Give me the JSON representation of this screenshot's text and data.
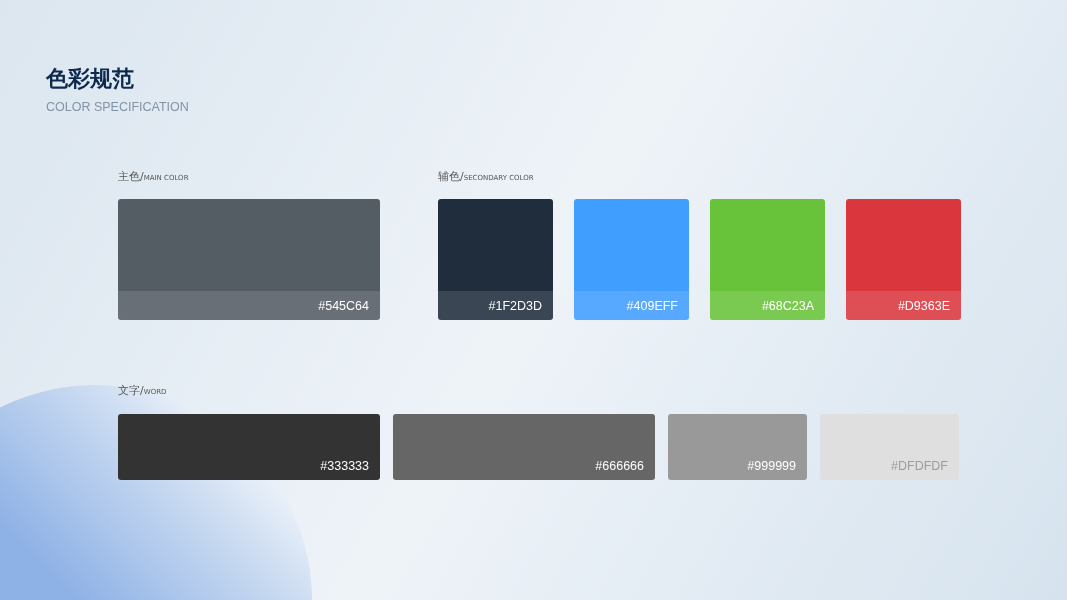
{
  "title": "色彩规范",
  "subtitle": "COLOR SPECIFICATION",
  "main": {
    "label": {
      "cn": "主色/",
      "en": "MAIN COLOR"
    },
    "swatches": [
      {
        "color": "#545c64",
        "label": "#545C64"
      }
    ]
  },
  "secondary": {
    "label": {
      "cn": "辅色/",
      "en": "SECONDARY COLOR"
    },
    "swatches": [
      {
        "color": "#1f2d3d",
        "label": "#1F2D3D"
      },
      {
        "color": "#409eff",
        "label": "#409EFF"
      },
      {
        "color": "#68c23a",
        "label": "#68C23A"
      },
      {
        "color": "#d9363e",
        "label": "#D9363E"
      }
    ]
  },
  "word": {
    "label": {
      "cn": "文字/",
      "en": "WORD"
    },
    "swatches": [
      {
        "color": "#333333",
        "label": "#333333"
      },
      {
        "color": "#666666",
        "label": "#666666"
      },
      {
        "color": "#999999",
        "label": "#999999"
      },
      {
        "color": "#dfdfdf",
        "label": "#DFDFDF"
      }
    ]
  }
}
